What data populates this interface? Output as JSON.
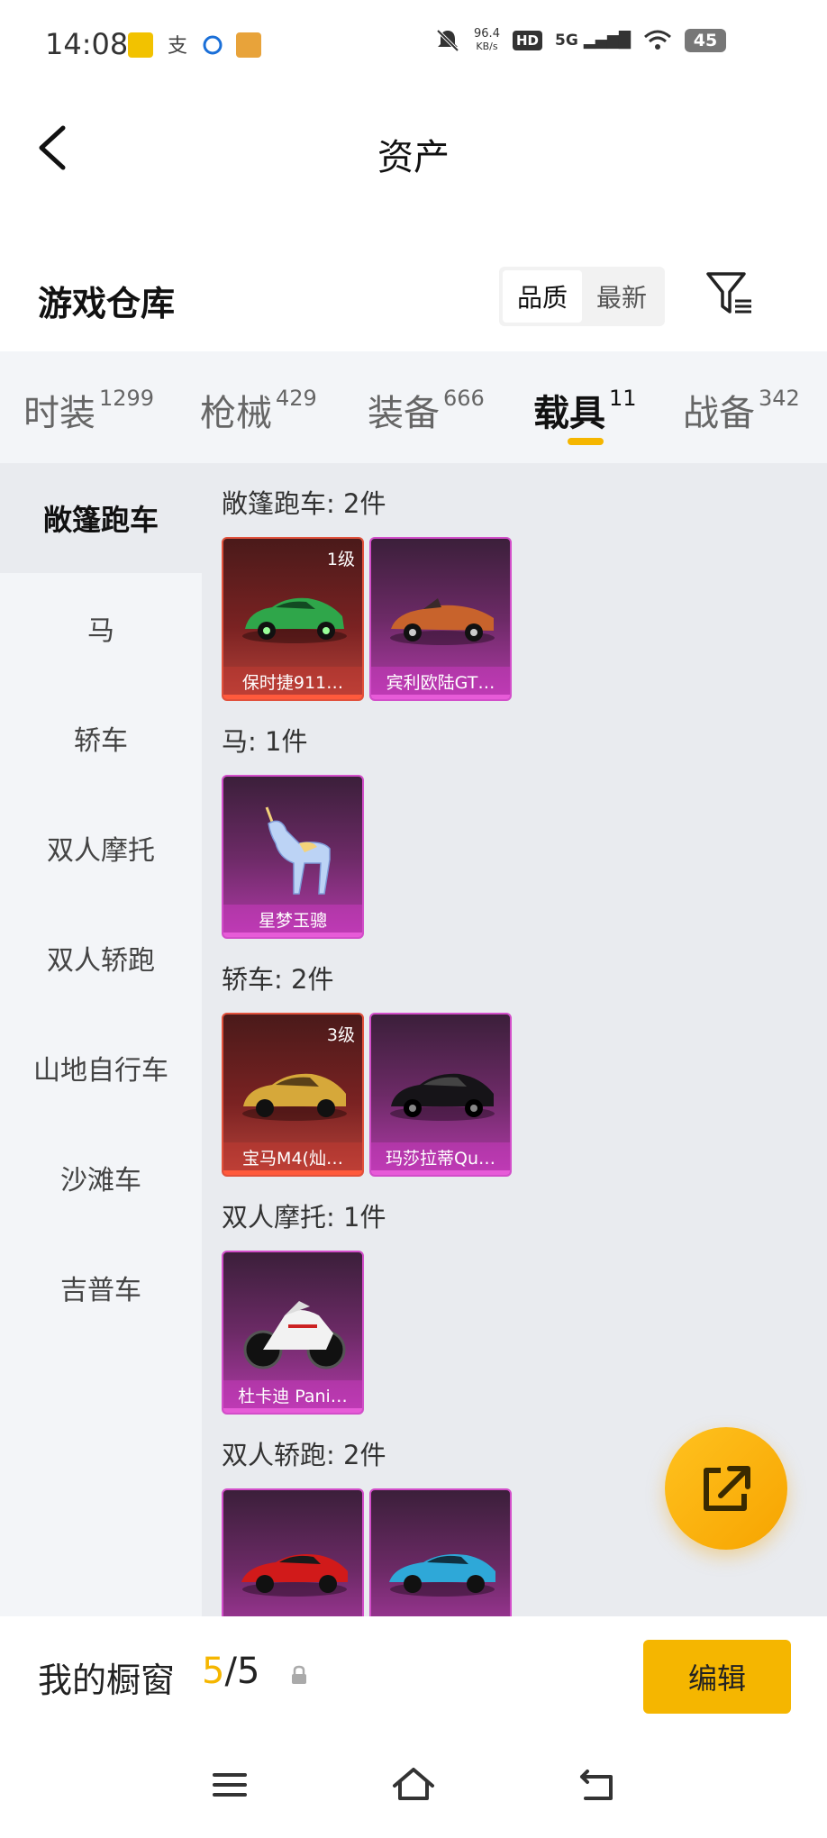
{
  "status_bar": {
    "time": "14:08",
    "net_speed_value": "96.4",
    "net_speed_unit": "KB/s",
    "hd": "HD",
    "signal": "5G",
    "battery": "45"
  },
  "header": {
    "title": "资产",
    "back_icon": "chevron-left-icon"
  },
  "warehouse": {
    "title": "游戏仓库",
    "sort_options": [
      {
        "label": "品质",
        "active": true
      },
      {
        "label": "最新",
        "active": false
      }
    ],
    "filter_icon": "filter-icon"
  },
  "tabs": [
    {
      "label": "时装",
      "count": "1299",
      "active": false
    },
    {
      "label": "枪械",
      "count": "429",
      "active": false
    },
    {
      "label": "装备",
      "count": "666",
      "active": false
    },
    {
      "label": "载具",
      "count": "11",
      "active": true
    },
    {
      "label": "战备",
      "count": "342",
      "active": false
    }
  ],
  "sidebar": {
    "items": [
      {
        "label": "敞篷跑车",
        "active": true
      },
      {
        "label": "马",
        "active": false
      },
      {
        "label": "轿车",
        "active": false
      },
      {
        "label": "双人摩托",
        "active": false
      },
      {
        "label": "双人轿跑",
        "active": false
      },
      {
        "label": "山地自行车",
        "active": false
      },
      {
        "label": "沙滩车",
        "active": false
      },
      {
        "label": "吉普车",
        "active": false
      }
    ]
  },
  "sections": [
    {
      "title": "敞篷跑车: 2件",
      "items": [
        {
          "name": "保时捷911…",
          "level": "1级",
          "rarity": "red",
          "art": "green-car"
        },
        {
          "name": "宾利欧陆GT…",
          "level": "",
          "rarity": "purple",
          "art": "orange-convertible"
        }
      ]
    },
    {
      "title": "马: 1件",
      "items": [
        {
          "name": "星梦玉骢",
          "level": "",
          "rarity": "purple",
          "art": "unicorn"
        }
      ]
    },
    {
      "title": "轿车: 2件",
      "items": [
        {
          "name": "宝马M4(灿…",
          "level": "3级",
          "rarity": "red",
          "art": "gold-car"
        },
        {
          "name": "玛莎拉蒂Qu…",
          "level": "",
          "rarity": "purple",
          "art": "black-car"
        }
      ]
    },
    {
      "title": "双人摩托: 1件",
      "items": [
        {
          "name": "杜卡迪 Pani…",
          "level": "",
          "rarity": "purple",
          "art": "motorcycle"
        }
      ]
    },
    {
      "title": "双人轿跑: 2件",
      "items": [
        {
          "name": "",
          "level": "",
          "rarity": "purple",
          "art": "red-sportscar"
        },
        {
          "name": "",
          "level": "",
          "rarity": "purple",
          "art": "blue-sportscar"
        }
      ]
    }
  ],
  "share_fab": {
    "icon": "share-icon"
  },
  "bottom": {
    "showcase_label": "我的橱窗",
    "showcase_current": "5",
    "showcase_sep": "/",
    "showcase_total": "5",
    "edit_label": "编辑"
  },
  "nav": {
    "menu_icon": "menu-icon",
    "home_icon": "home-icon",
    "back_icon": "back-icon"
  }
}
